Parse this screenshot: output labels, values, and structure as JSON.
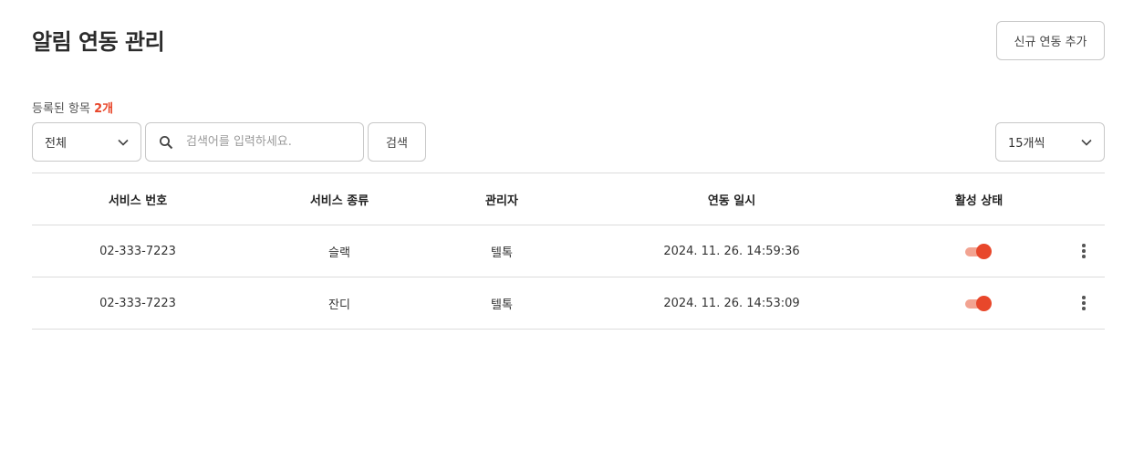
{
  "header": {
    "title": "알림 연동 관리",
    "add_button_label": "신규 연동 추가"
  },
  "summary": {
    "count_label": "등록된 항목",
    "count_value": "2개"
  },
  "filters": {
    "category_selected": "전체",
    "search_placeholder": "검색어를 입력하세요.",
    "search_value": "",
    "search_button_label": "검색",
    "page_size_selected": "15개씩"
  },
  "table": {
    "columns": [
      "서비스 번호",
      "서비스 종류",
      "관리자",
      "연동 일시",
      "활성 상태"
    ],
    "rows": [
      {
        "service_number": "02-333-7223",
        "service_type": "슬랙",
        "manager": "텔톡",
        "linked_at": "2024. 11. 26. 14:59:36",
        "active": true
      },
      {
        "service_number": "02-333-7223",
        "service_type": "잔디",
        "manager": "텔톡",
        "linked_at": "2024. 11. 26. 14:53:09",
        "active": true
      }
    ]
  },
  "colors": {
    "accent": "#e8472b",
    "toggle_track": "#f2a391",
    "border": "#c8c8c8",
    "divider": "#dcdcdc"
  },
  "icons": {
    "search": "search-icon",
    "dropdown": "chevron-down-icon",
    "row_menu": "more-vertical-icon"
  }
}
